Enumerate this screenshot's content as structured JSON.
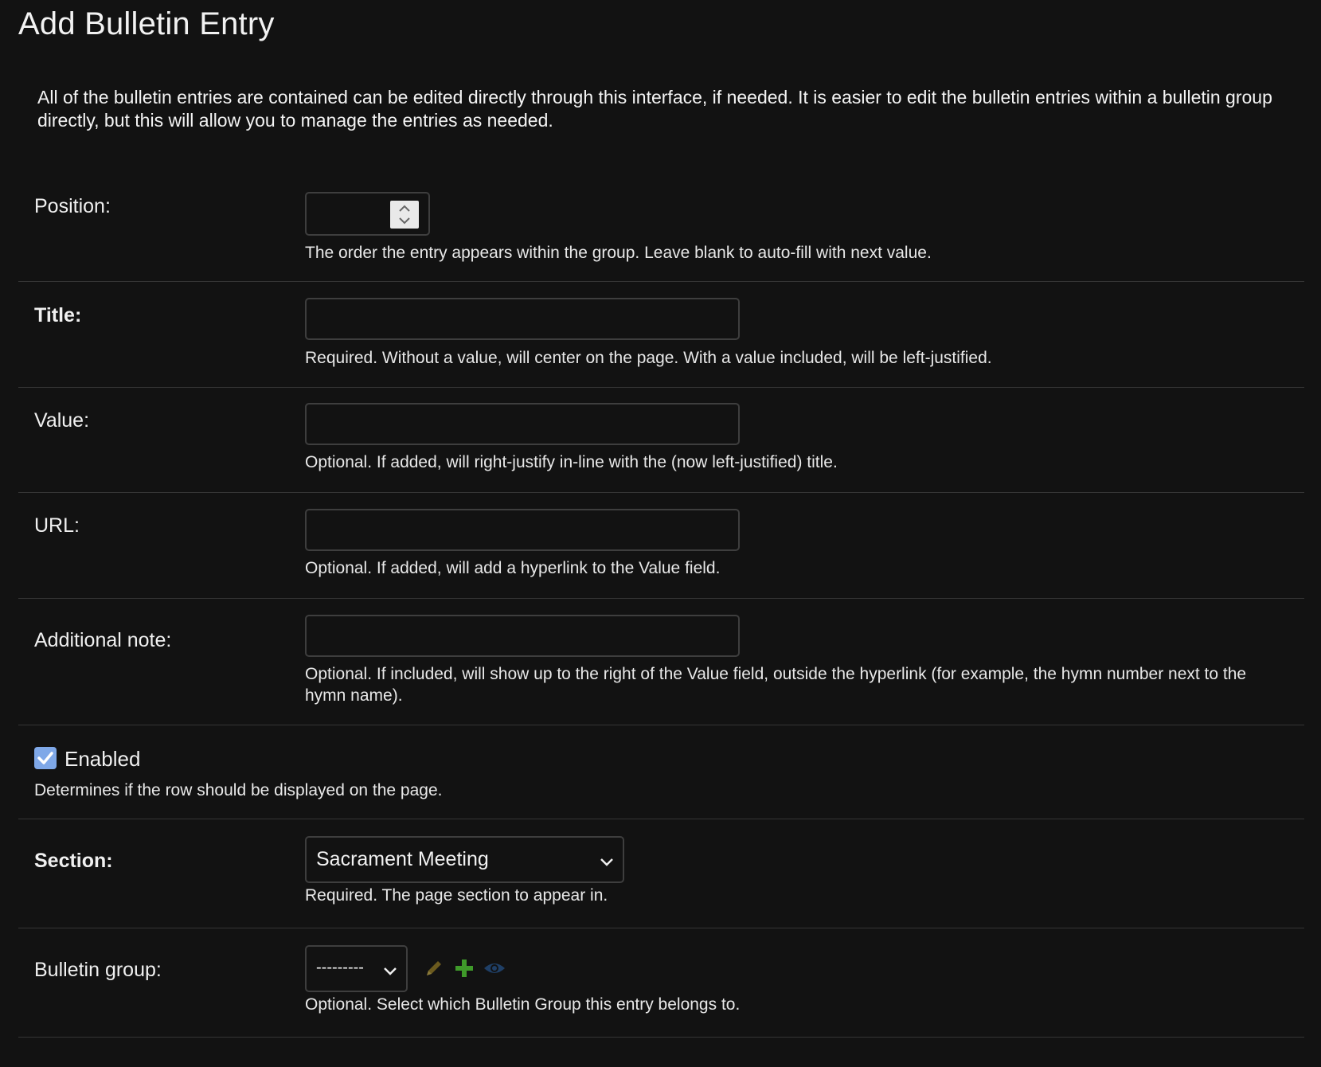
{
  "page": {
    "title": "Add Bulletin Entry",
    "intro": "All of the bulletin entries are contained can be edited directly through this interface, if needed. It is easier to edit the bulletin entries within a bulletin group directly, but this will allow you to manage the entries as needed."
  },
  "fields": {
    "position": {
      "label": "Position:",
      "value": "",
      "help": "The order the entry appears within the group. Leave blank to auto-fill with next value."
    },
    "title": {
      "label": "Title:",
      "value": "",
      "help": "Required. Without a value, will center on the page. With a value included, will be left-justified."
    },
    "value": {
      "label": "Value:",
      "value": "",
      "help": "Optional. If added, will right-justify in-line with the (now left-justified) title."
    },
    "url": {
      "label": "URL:",
      "value": "",
      "help": "Optional. If added, will add a hyperlink to the Value field."
    },
    "additional_note": {
      "label": "Additional note:",
      "value": "",
      "help": "Optional. If included, will show up to the right of the Value field, outside the hyperlink (for example, the hymn number next to the hymn name)."
    },
    "enabled": {
      "label": "Enabled",
      "checked": true,
      "help": "Determines if the row should be displayed on the page."
    },
    "section": {
      "label": "Section:",
      "selected": "Sacrament Meeting",
      "help": "Required. The page section to appear in."
    },
    "bulletin_group": {
      "label": "Bulletin group:",
      "selected": "---------",
      "help": "Optional. Select which Bulletin Group this entry belongs to.",
      "actions": [
        "pencil-icon",
        "plus-icon",
        "eye-icon"
      ]
    }
  },
  "colors": {
    "background": "#121212",
    "checkbox": "#7fa8e8",
    "pencil": "#6b5a1e",
    "plus": "#3f9a2a",
    "eye": "#1f3f66"
  }
}
